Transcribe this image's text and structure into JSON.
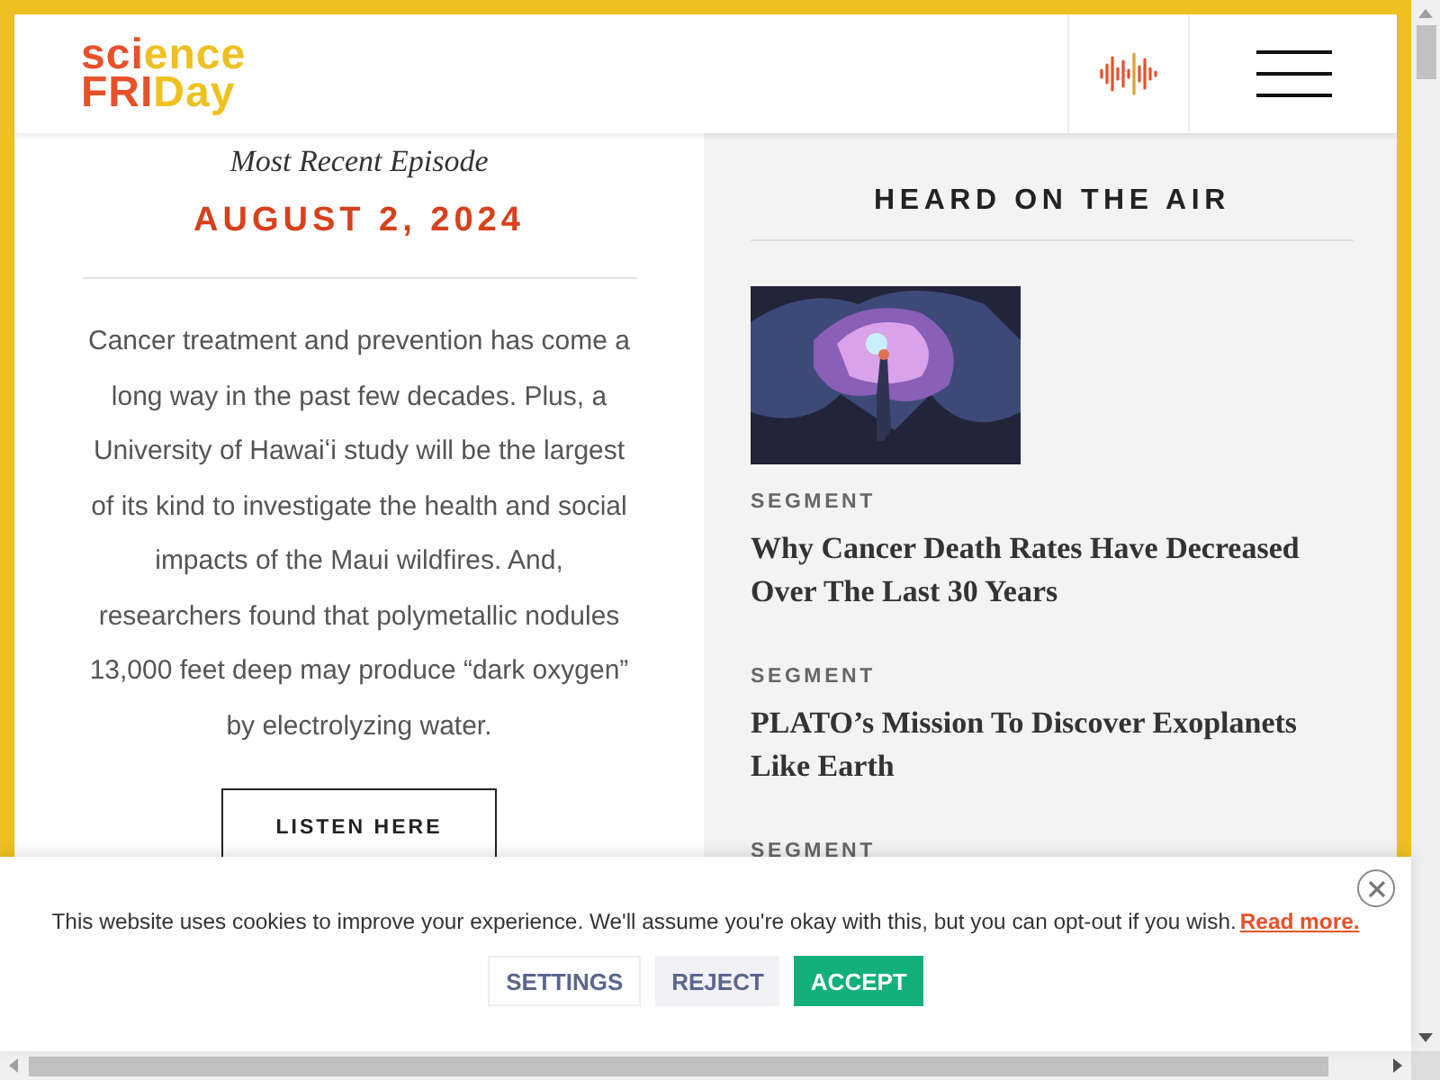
{
  "header": {
    "logo": [
      [
        "sci",
        "ence"
      ],
      [
        "FRI",
        "Day"
      ]
    ]
  },
  "episode": {
    "kicker": "Most Recent Episode",
    "date": "AUGUST 2, 2024",
    "summary": "Cancer treatment and prevention has come a long way in the past few decades. Plus, a University of Hawaiʻi study will be the largest of its kind to investigate the health and social impacts of the Maui wildfires. And, researchers found that polymetallic nodules 13,000 feet deep may produce “dark oxygen” by electrolyzing water.",
    "button": "LISTEN HERE"
  },
  "heard_on_the_air": {
    "title": "HEARD ON THE AIR",
    "items": [
      {
        "kind": "image",
        "label": "SEGMENT",
        "title": "Why Cancer Death Rates Have Decreased Over The Last 30 Years"
      },
      {
        "kind": "plain",
        "label": "SEGMENT",
        "title": "PLATO’s Mission To Discover Exoplanets Like Earth"
      },
      {
        "kind": "plain",
        "label": "SEGMENT"
      }
    ]
  },
  "cookie_banner": {
    "message": "This website uses cookies to improve your experience. We'll assume you're okay with this, but you can opt-out if you wish.",
    "link": "Read more.",
    "buttons": [
      {
        "kind": "settings",
        "label": "SETTINGS"
      },
      {
        "kind": "reject",
        "label": "REJECT"
      },
      {
        "kind": "accept",
        "label": "ACCEPT"
      }
    ]
  }
}
